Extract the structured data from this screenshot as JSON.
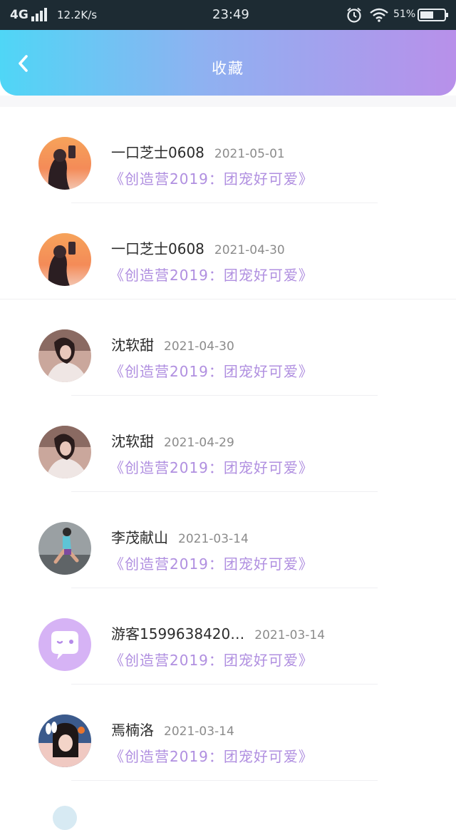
{
  "status_bar": {
    "network": "4G",
    "speed": "12.2K/s",
    "time": "23:49",
    "battery": "51%",
    "icons": [
      "signal-icon",
      "alarm-icon",
      "wifi-icon",
      "battery-icon"
    ]
  },
  "header": {
    "back_icon": "chevron-left-icon",
    "title": "收藏",
    "gradient": [
      "#4fd6f6",
      "#b890ea"
    ]
  },
  "favorites": [
    {
      "name": "一口芝士0608",
      "date": "2021-05-01",
      "post": "《创造营2019：团宠好可爱》",
      "avatar": "sunset-girl"
    },
    {
      "name": "一口芝士0608",
      "date": "2021-04-30",
      "post": "《创造营2019：团宠好可爱》",
      "avatar": "sunset-girl"
    },
    {
      "name": "沈软甜",
      "date": "2021-04-30",
      "post": "《创造营2019：团宠好可爱》",
      "avatar": "portrait-girl"
    },
    {
      "name": "沈软甜",
      "date": "2021-04-29",
      "post": "《创造营2019：团宠好可爱》",
      "avatar": "portrait-girl"
    },
    {
      "name": "李茂献山",
      "date": "2021-03-14",
      "post": "《创造营2019：团宠好可爱》",
      "avatar": "runner"
    },
    {
      "name": "游客1599638420…",
      "date": "2021-03-14",
      "post": "《创造营2019：团宠好可爱》",
      "avatar": "default-chat-bubble"
    },
    {
      "name": "焉楠洛",
      "date": "2021-03-14",
      "post": "《创造营2019：团宠好可爱》",
      "avatar": "girl-bunny"
    }
  ],
  "colors": {
    "post_link": "#b08fe0",
    "status_bar": "#1d2b33",
    "default_avatar": "#d6b3f5"
  }
}
